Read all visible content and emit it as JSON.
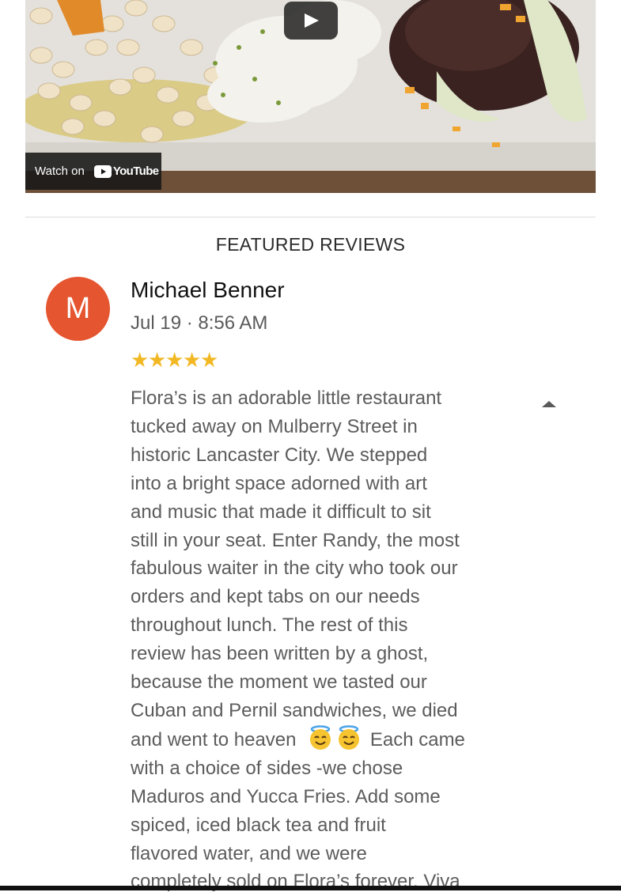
{
  "video": {
    "watch_on_label": "Watch on",
    "youtube_brand": "YouTube",
    "play_icon": "play-icon"
  },
  "featured": {
    "title": "FEATURED REVIEWS"
  },
  "review": {
    "avatar_initial": "M",
    "avatar_color": "#e5552f",
    "name": "Michael Benner",
    "date": "Jul 19 · 8:56 AM",
    "rating": 5,
    "stars": "★★★★★",
    "star_color": "#f2b824",
    "toggle_icon": "triangle-up-icon",
    "text_lines": [
      "Flora’s is an adorable little restaurant",
      "tucked away on Mulberry Street in",
      "historic Lancaster City. We stepped",
      "into a bright space adorned with art",
      "and music that made it difficult to sit",
      "still in your seat. Enter Randy, the most",
      "fabulous waiter in the city who took our",
      "orders and kept tabs on our needs",
      "throughout lunch. The rest of this",
      "review has been written by a ghost,",
      "because the moment we tasted our",
      "Cuban and Pernil sandwiches, we died",
      "and went to heaven",
      "Each came",
      "with a choice of sides -we chose",
      "Maduros and Yucca Fries. Add some",
      "spiced, iced black tea and fruit",
      "flavored water, and we were",
      "completely sold on Flora’s forever. Viva"
    ],
    "emoji_icons": [
      "smiling-face-with-halo-icon",
      "smiling-face-with-halo-icon"
    ]
  }
}
